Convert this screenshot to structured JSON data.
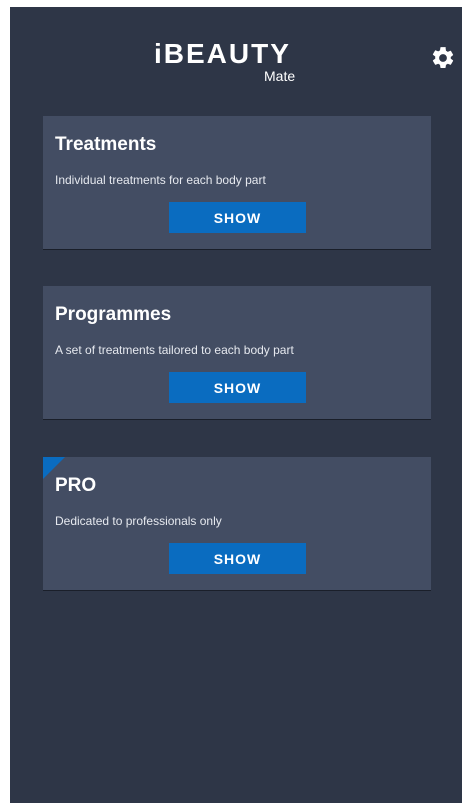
{
  "app": {
    "logo_main": "iBEAUTY",
    "logo_sub": "Mate"
  },
  "header": {
    "settings_icon": "gear-icon"
  },
  "cards": [
    {
      "title": "Treatments",
      "description": "Individual treatments for each body part",
      "button_label": "SHOW"
    },
    {
      "title": "Programmes",
      "description": "A set of treatments tailored to each body part",
      "button_label": "SHOW"
    },
    {
      "title": "PRO",
      "description": "Dedicated to professionals only",
      "button_label": "SHOW"
    }
  ],
  "colors": {
    "background": "#2e3647",
    "card": "#434d63",
    "accent": "#0a6cc0",
    "text": "#ffffff"
  }
}
